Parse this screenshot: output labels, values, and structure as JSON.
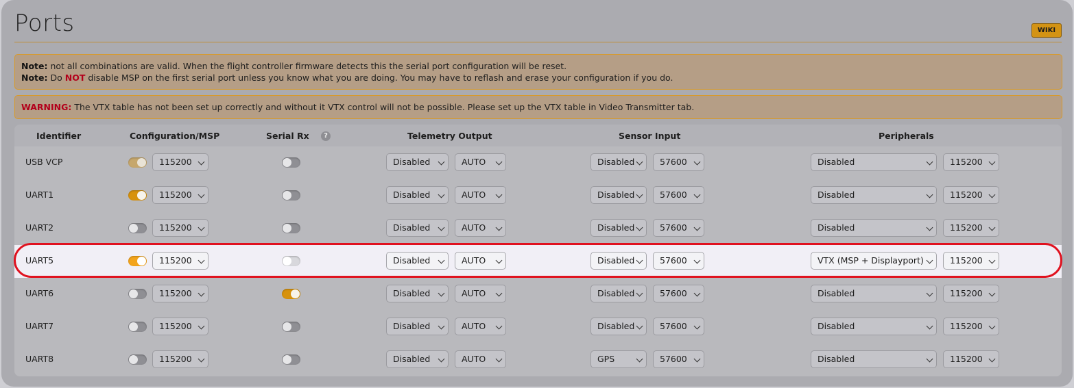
{
  "page": {
    "title": "Ports",
    "wiki_label": "WIKI",
    "note1_label": "Note:",
    "note1_text": " not all combinations are valid. When the flight controller firmware detects this the serial port configuration will be reset.",
    "note2_label": "Note:",
    "note2_pre": " Do ",
    "note2_not": "NOT",
    "note2_post": " disable MSP on the first serial port unless you know what you are doing. You may have to reflash and erase your configuration if you do.",
    "warning_label": "WARNING:",
    "warning_text": " The VTX table has not been set up correctly and without it VTX control will not be possible. Please set up the VTX table in Video Transmitter tab.",
    "help_icon": "?"
  },
  "columns": {
    "identifier": "Identifier",
    "config_msp": "Configuration/MSP",
    "serial_rx": "Serial Rx",
    "telemetry": "Telemetry Output",
    "sensor": "Sensor Input",
    "peripherals": "Peripherals"
  },
  "rows": [
    {
      "id": "USB VCP",
      "msp": "on-dim",
      "msp_baud": "115200",
      "rx": "off",
      "tel": "Disabled",
      "tel_baud": "AUTO",
      "sen": "Disabled",
      "sen_baud": "57600",
      "per": "Disabled",
      "per_baud": "115200"
    },
    {
      "id": "UART1",
      "msp": "on",
      "msp_baud": "115200",
      "rx": "off",
      "tel": "Disabled",
      "tel_baud": "AUTO",
      "sen": "Disabled",
      "sen_baud": "57600",
      "per": "Disabled",
      "per_baud": "115200"
    },
    {
      "id": "UART2",
      "msp": "off",
      "msp_baud": "115200",
      "rx": "off",
      "tel": "Disabled",
      "tel_baud": "AUTO",
      "sen": "Disabled",
      "sen_baud": "57600",
      "per": "Disabled",
      "per_baud": "115200"
    },
    {
      "id": "UART5",
      "msp": "on",
      "msp_baud": "115200",
      "rx": "off",
      "tel": "Disabled",
      "tel_baud": "AUTO",
      "sen": "Disabled",
      "sen_baud": "57600",
      "per": "VTX (MSP + Displayport)",
      "per_baud": "115200"
    },
    {
      "id": "UART6",
      "msp": "off",
      "msp_baud": "115200",
      "rx": "on",
      "tel": "Disabled",
      "tel_baud": "AUTO",
      "sen": "Disabled",
      "sen_baud": "57600",
      "per": "Disabled",
      "per_baud": "115200"
    },
    {
      "id": "UART7",
      "msp": "off",
      "msp_baud": "115200",
      "rx": "off",
      "tel": "Disabled",
      "tel_baud": "AUTO",
      "sen": "Disabled",
      "sen_baud": "57600",
      "per": "Disabled",
      "per_baud": "115200"
    },
    {
      "id": "UART8",
      "msp": "off",
      "msp_baud": "115200",
      "rx": "off",
      "tel": "Disabled",
      "tel_baud": "AUTO",
      "sen": "GPS",
      "sen_baud": "57600",
      "per": "Disabled",
      "per_baud": "115200"
    }
  ],
  "highlighted_row": "UART5",
  "colors": {
    "accent": "#d7920d",
    "warning": "#b3001b",
    "highlight_ring": "#e0121f"
  }
}
